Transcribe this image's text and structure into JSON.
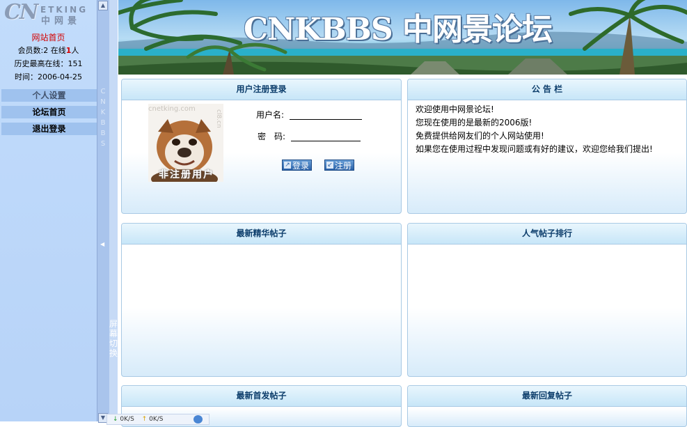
{
  "sidebar": {
    "logo_cn": "CN",
    "logo_etking": "ETKING",
    "logo_zw": "中网景",
    "home_link": "网站首页",
    "members_prefix": "会员数:2  在线",
    "online_count": "1",
    "members_suffix": "人",
    "history_peak": "历史最高在线：151",
    "time": "时间：2006-04-25",
    "menu": {
      "settings": "个人设置",
      "forum_home": "论坛首页",
      "logout": "退出登录"
    }
  },
  "splitter": {
    "vertical_brand": "CNKBBS",
    "switch_label": "屏幕切换"
  },
  "tray": {
    "down": "0K/S",
    "up": "0K/S"
  },
  "banner": {
    "title": "CNKBBS 中网景论坛"
  },
  "panels": {
    "login": {
      "title": "用户注册登录",
      "image_caption": "非注册用户",
      "image_watermark": "cnetking.com",
      "image_watermark2": "cl8.cn",
      "username_label": "用户名:",
      "password_label": "密　码:",
      "username_value": "",
      "password_value": "",
      "login_button": "登录",
      "register_button": "注册"
    },
    "notice": {
      "title": "公 告 栏",
      "lines": [
        "欢迎使用中网景论坛!",
        "您现在使用的是最新的2006版!",
        "免费提供给网友们的个人网站使用!",
        "如果您在使用过程中发现问题或有好的建议，欢迎您给我们提出!"
      ]
    },
    "best_posts": {
      "title": "最新精华帖子"
    },
    "hot_posts": {
      "title": "人气帖子排行"
    },
    "newest_posts": {
      "title": "最新首发帖子"
    },
    "latest_replies": {
      "title": "最新回复帖子"
    }
  },
  "colors": {
    "panel_header_text": "#0c3d6b",
    "panel_border": "#a8c9e4",
    "sidebar_bg": "#c2dcfb",
    "link_red": "#d40000"
  }
}
